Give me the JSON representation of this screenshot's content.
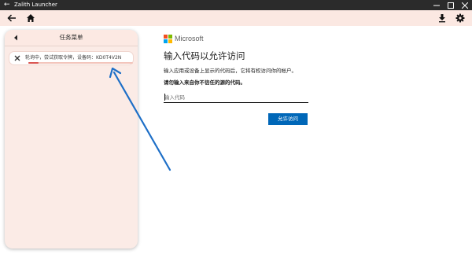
{
  "window": {
    "title": "Zalith Launcher",
    "back_glyph": "←"
  },
  "toolbar": {
    "back_icon": "arrow-left-icon",
    "home_icon": "home-icon",
    "download_icon": "download-icon",
    "settings_icon": "gear-icon"
  },
  "task_panel": {
    "title": "任务菜单",
    "tasks": [
      {
        "text": "轮询中，尝试获取令牌，设备码：KD0T4V2N",
        "progress": 0.1
      }
    ]
  },
  "signin": {
    "brand": "Microsoft",
    "title": "输入代码以允许访问",
    "description": "输入应用或设备上显示的代码后，它将有权访问你的帐户。",
    "warning": "请勿输入来自你不信任的源的代码。",
    "input_value": "",
    "input_placeholder": "输入代码",
    "submit_label": "允许访问",
    "colors": {
      "button": "#0067b8",
      "logo_red": "#f25022",
      "logo_green": "#7fba00",
      "logo_blue": "#00a4ef",
      "logo_yellow": "#ffb900"
    }
  },
  "annotation": {
    "color": "#1e6fc7"
  }
}
